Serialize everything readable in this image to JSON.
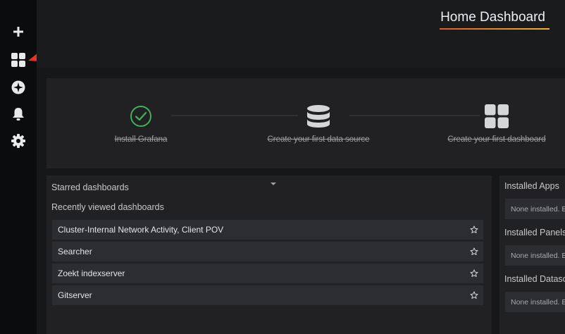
{
  "header": {
    "title": "Home Dashboard"
  },
  "sidebar": {
    "items": [
      {
        "name": "create",
        "icon": "plus-icon"
      },
      {
        "name": "dashboards",
        "icon": "grid-icon"
      },
      {
        "name": "explore",
        "icon": "compass-icon"
      },
      {
        "name": "alerting",
        "icon": "bell-icon"
      },
      {
        "name": "configuration",
        "icon": "gear-icon"
      }
    ]
  },
  "onboarding": {
    "steps": [
      {
        "label": "Install Grafana",
        "icon": "check-circle-icon",
        "done": true
      },
      {
        "label": "Create your first data source",
        "icon": "database-icon",
        "done": true
      },
      {
        "label": "Create your first dashboard",
        "icon": "grid-icon",
        "done": true
      }
    ]
  },
  "dashboards": {
    "starred_title": "Starred dashboards",
    "recent_title": "Recently viewed dashboards",
    "recent": [
      "Cluster-Internal Network Activity, Client POV",
      "Searcher",
      "Zoekt indexserver",
      "Gitserver"
    ]
  },
  "installed": {
    "apps_title": "Installed Apps",
    "apps_text": "None installed. B",
    "panels_title": "Installed Panels",
    "panels_text": "None installed. B",
    "datasources_title": "Installed Datasc",
    "datasources_text": "None installed. B"
  },
  "colors": {
    "accent_orange": "#e05a26",
    "accent_yellow": "#f5b02c",
    "success_green": "#3eb15b",
    "annotation_arrow": "#e8341f"
  }
}
